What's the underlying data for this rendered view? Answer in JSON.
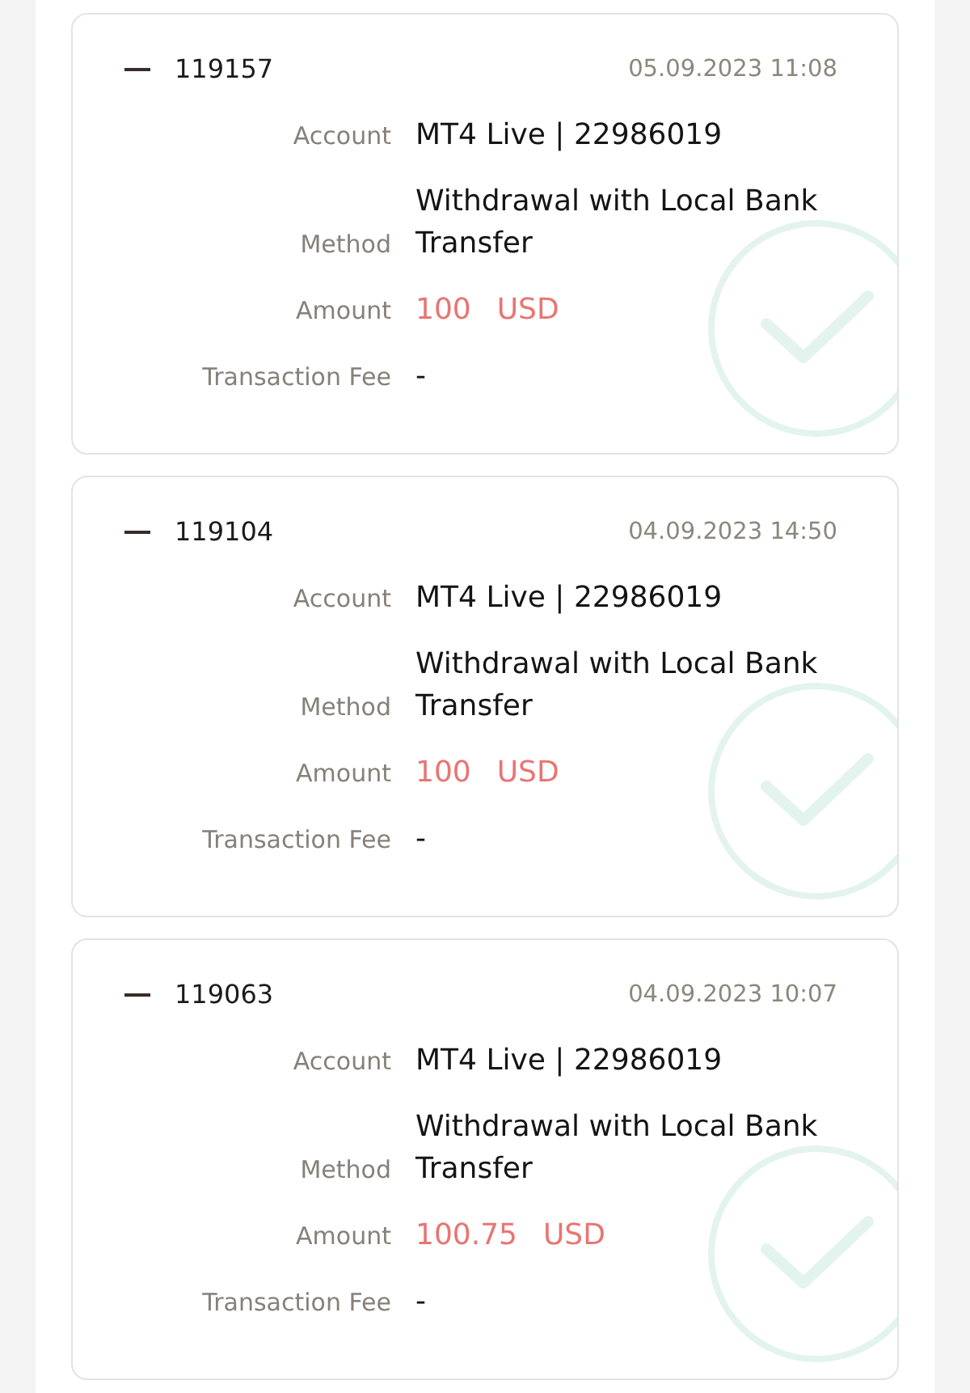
{
  "transactions": [
    {
      "id": "119157",
      "expanded": true,
      "date": "05.09.2023 11:08",
      "completed": true,
      "fields": [
        {
          "kind": "text",
          "label": "Account",
          "value": "MT4 Live | 22986019"
        },
        {
          "kind": "text",
          "label": "Method",
          "value": "Withdrawal with Local Bank Transfer"
        },
        {
          "kind": "amount",
          "label": "Amount",
          "value": "100",
          "currency": "USD"
        },
        {
          "kind": "text",
          "label": "Transaction Fee",
          "value": "-"
        }
      ]
    },
    {
      "id": "119104",
      "expanded": true,
      "date": "04.09.2023 14:50",
      "completed": true,
      "fields": [
        {
          "kind": "text",
          "label": "Account",
          "value": "MT4 Live | 22986019"
        },
        {
          "kind": "text",
          "label": "Method",
          "value": "Withdrawal with Local Bank Transfer"
        },
        {
          "kind": "amount",
          "label": "Amount",
          "value": "100",
          "currency": "USD"
        },
        {
          "kind": "text",
          "label": "Transaction Fee",
          "value": "-"
        }
      ]
    },
    {
      "id": "119063",
      "expanded": true,
      "date": "04.09.2023 10:07",
      "completed": true,
      "fields": [
        {
          "kind": "text",
          "label": "Account",
          "value": "MT4 Live | 22986019"
        },
        {
          "kind": "text",
          "label": "Method",
          "value": "Withdrawal with Local Bank Transfer"
        },
        {
          "kind": "amount",
          "label": "Amount",
          "value": "100.75",
          "currency": "USD"
        },
        {
          "kind": "text",
          "label": "Transaction Fee",
          "value": "-"
        }
      ]
    }
  ]
}
